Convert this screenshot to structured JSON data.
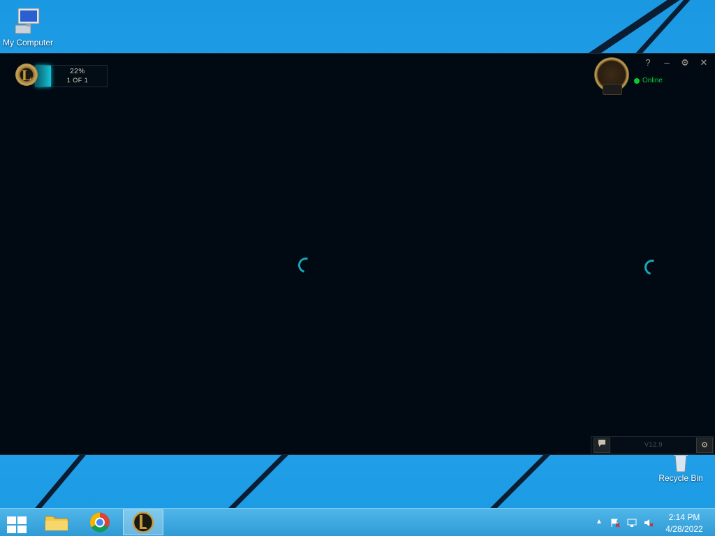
{
  "desktop": {
    "icons": [
      {
        "label": "My Computer",
        "icon": "computer-icon"
      },
      {
        "label": "Recycle Bin",
        "icon": "recycle-bin-icon"
      }
    ]
  },
  "client": {
    "patcher": {
      "progress_text": "22%",
      "count_text": "1 OF 1",
      "progress": 0.22,
      "logo_letter": "L"
    },
    "window_controls": {
      "help": "?",
      "minimize": "–",
      "settings": "⚙",
      "close": "✕"
    },
    "profile": {
      "status": "Online",
      "status_color": "#0acb2e"
    },
    "footer": {
      "chat_icon": "chat-icon",
      "version": "V12.9",
      "settings_icon": "gear-icon"
    }
  },
  "taskbar": {
    "pinned": [
      {
        "name": "file-explorer",
        "icon": "folder-icon"
      },
      {
        "name": "google-chrome",
        "icon": "chrome-icon"
      },
      {
        "name": "league-of-legends",
        "icon": "lol-icon",
        "active": true
      }
    ],
    "tray": {
      "show_hidden": "▲"
    },
    "clock": {
      "time": "2:14 PM",
      "date": "4/28/2022"
    }
  },
  "colors": {
    "accent": "#16c2d6",
    "gold": "#c89b3c",
    "client_bg": "#010a13"
  }
}
